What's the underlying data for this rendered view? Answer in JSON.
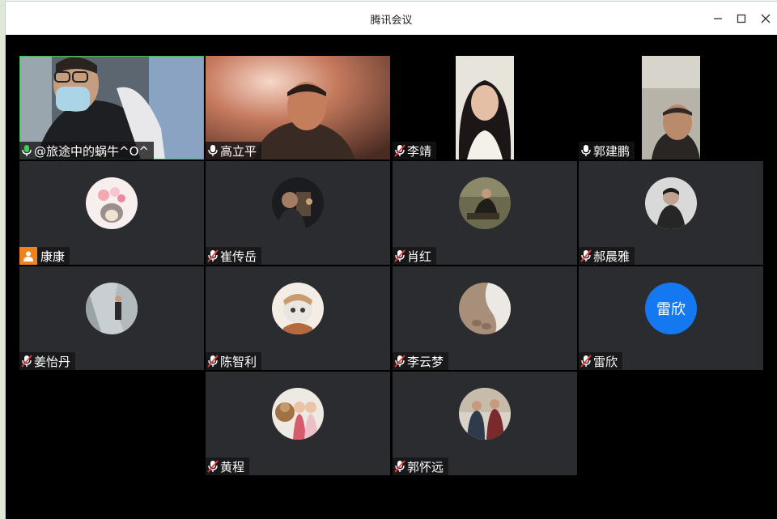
{
  "window": {
    "title": "腾讯会议",
    "controls": [
      "minimize-icon",
      "maximize-icon",
      "close-icon"
    ]
  },
  "participants": [
    {
      "name": "@旅途中的蜗牛^O^",
      "mic": "on",
      "video": true,
      "speaking": true
    },
    {
      "name": "高立平",
      "mic": "on",
      "video": true
    },
    {
      "name": "李靖",
      "mic": "muted",
      "video": true
    },
    {
      "name": "郭建鹏",
      "mic": "on",
      "video": true
    },
    {
      "name": "康康",
      "mic": "none",
      "video": false,
      "avatar": "avatar-image"
    },
    {
      "name": "崔传岳",
      "mic": "muted",
      "video": false,
      "avatar": "avatar-image"
    },
    {
      "name": "肖红",
      "mic": "muted",
      "video": false,
      "avatar": "avatar-image"
    },
    {
      "name": "郝晨雅",
      "mic": "muted",
      "video": false,
      "avatar": "avatar-image"
    },
    {
      "name": "姜怡丹",
      "mic": "muted",
      "video": false,
      "avatar": "avatar-image"
    },
    {
      "name": "陈智利",
      "mic": "muted",
      "video": false,
      "avatar": "avatar-image"
    },
    {
      "name": "李云梦",
      "mic": "muted",
      "video": false,
      "avatar": "avatar-image"
    },
    {
      "name": "雷欣",
      "mic": "muted",
      "video": false,
      "avatar_text": "雷欣",
      "avatar_color": "#1479f0"
    },
    {
      "name": "黄程",
      "mic": "muted",
      "video": false,
      "avatar": "avatar-image"
    },
    {
      "name": "郭怀远",
      "mic": "muted",
      "video": false,
      "avatar": "avatar-image"
    }
  ],
  "colors": {
    "speaking_border": "#3fbf59",
    "tile_bg": "#2b2c2f",
    "badge": "#f0821e"
  }
}
